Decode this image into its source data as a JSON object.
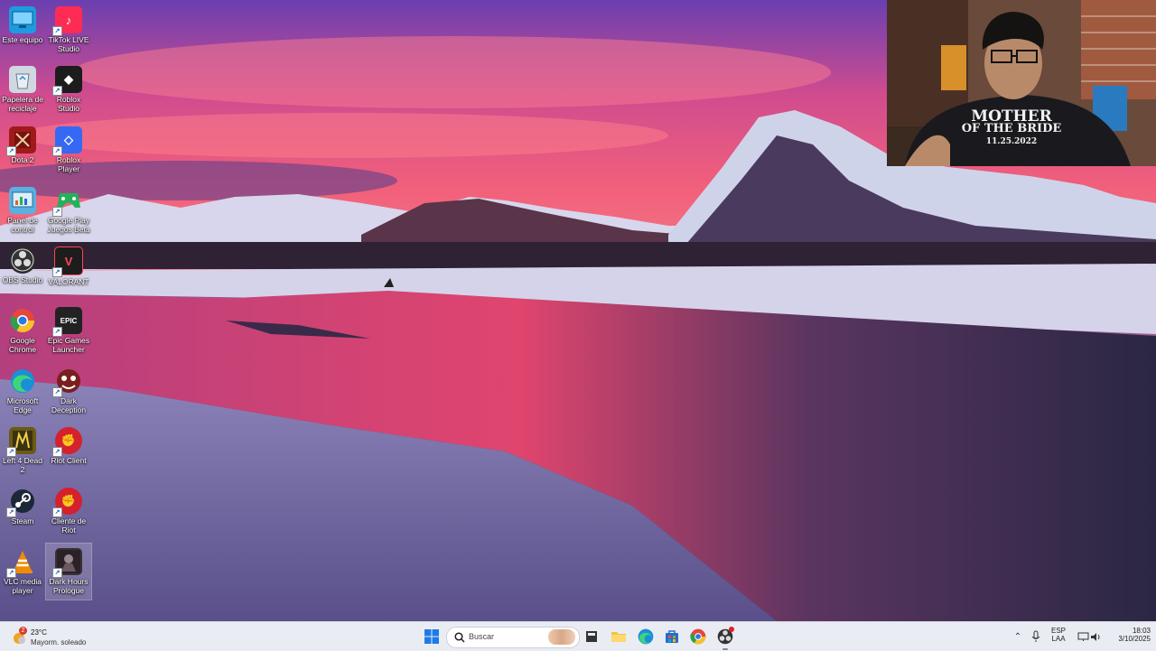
{
  "desktop_icons": [
    {
      "label": "Este equipo",
      "icon": "computer-icon",
      "color": "#1e9be0"
    },
    {
      "label": "TikTok LIVE Studio",
      "icon": "tiktok-icon",
      "color": "#fe2c55"
    },
    {
      "label": "Papelera de reciclaje",
      "icon": "recycle-bin-icon",
      "color": "#cfd8e0"
    },
    {
      "label": "Roblox Studio",
      "icon": "roblox-studio-icon",
      "color": "#1c1c1c"
    },
    {
      "label": "Dota 2",
      "icon": "dota2-icon",
      "color": "#a11a1a"
    },
    {
      "label": "Roblox Player",
      "icon": "roblox-player-icon",
      "color": "#3569f4"
    },
    {
      "label": "Panel de control",
      "icon": "control-panel-icon",
      "color": "#5ab0e0"
    },
    {
      "label": "Google Play Juegos Beta",
      "icon": "google-play-games-icon",
      "color": "#23b15a"
    },
    {
      "label": "OBS Studio",
      "icon": "obs-icon",
      "color": "#2a2a2a"
    },
    {
      "label": "VALORANT",
      "icon": "valorant-icon",
      "color": "#ff4655"
    },
    {
      "label": "Google Chrome",
      "icon": "chrome-icon",
      "color": "#e7473b"
    },
    {
      "label": "Epic Games Launcher",
      "icon": "epic-games-icon",
      "color": "#222222"
    },
    {
      "label": "Microsoft Edge",
      "icon": "edge-icon",
      "color": "#0f9b8e"
    },
    {
      "label": "Dark Deception",
      "icon": "dark-deception-icon",
      "color": "#7a1f1f"
    },
    {
      "label": "Left 4 Dead 2",
      "icon": "left4dead2-icon",
      "color": "#6b5a14"
    },
    {
      "label": "Riot Client",
      "icon": "riot-client-icon",
      "color": "#d5202e"
    },
    {
      "label": "Steam",
      "icon": "steam-icon",
      "color": "#1b2838"
    },
    {
      "label": "Cliente de Riot",
      "icon": "riot-client-icon",
      "color": "#d5202e"
    },
    {
      "label": "VLC media player",
      "icon": "vlc-icon",
      "color": "#f08c00"
    },
    {
      "label": "Dark Hours Prologue",
      "icon": "dark-hours-icon",
      "color": "#3a3236"
    }
  ],
  "icon_glyphs": {
    "tiktok": "♪",
    "roblox_studio": "◆",
    "roblox_player": "◇",
    "epic": "EPIC",
    "riot": "✊",
    "valorant": "V"
  },
  "webcam": {
    "shirt_line1": "MOTHER",
    "shirt_line2": "OF THE BRIDE",
    "shirt_line3": "11.25.2022"
  },
  "taskbar": {
    "weather_temp": "23°C",
    "weather_desc": "Mayorm. soleado",
    "weather_badge": "2",
    "search_placeholder": "Buscar",
    "lang_line1": "ESP",
    "lang_line2": "LAA",
    "time": "18:03",
    "date": "3/10/2025"
  }
}
